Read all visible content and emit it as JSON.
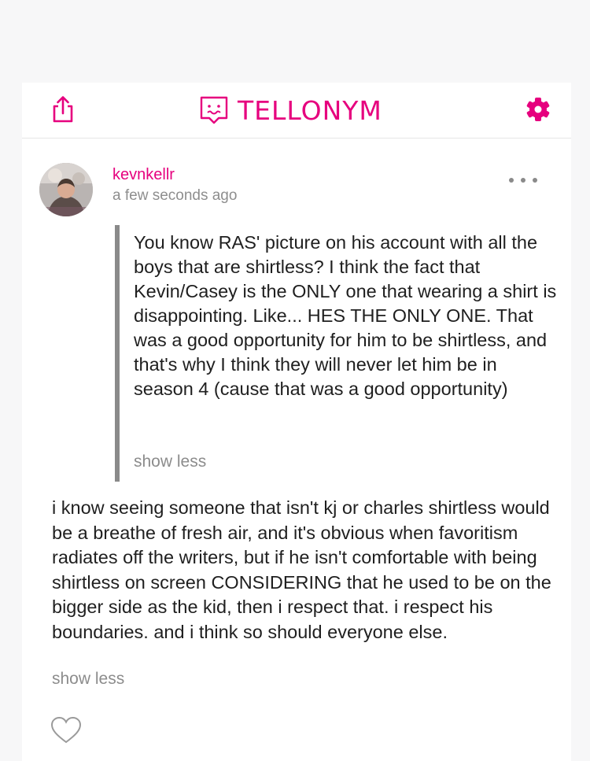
{
  "app": {
    "title": "TELLONYM",
    "accent_color": "#e6007e",
    "icons": {
      "left": "share-icon",
      "brand": "tellonym-logo-icon",
      "right": "gear-icon"
    }
  },
  "post": {
    "username": "kevnkellr",
    "timestamp": "a few seconds ago",
    "more_icon": "more-dots-icon",
    "question": "You know RAS' picture on his account with all the boys that are shirtless? I think the fact that Kevin/Casey is the ONLY one that wearing a shirt is disappointing. Like... HES THE ONLY ONE. That was a good opportunity for him to be shirtless, and that's why I think they will never let him be in season 4 (cause that was a good opportunity)",
    "question_toggle": "show less",
    "answer": "i know seeing someone that isn't kj or charles shirtless would be a breathe of fresh air, and it's obvious when favoritism radiates off the writers, but if he isn't comfortable with being shirtless on screen CONSIDERING that he used to be on the bigger side as the kid, then i respect that. i respect his boundaries. and i think so should everyone else.",
    "answer_toggle": "show less",
    "like_icon": "heart-icon"
  }
}
